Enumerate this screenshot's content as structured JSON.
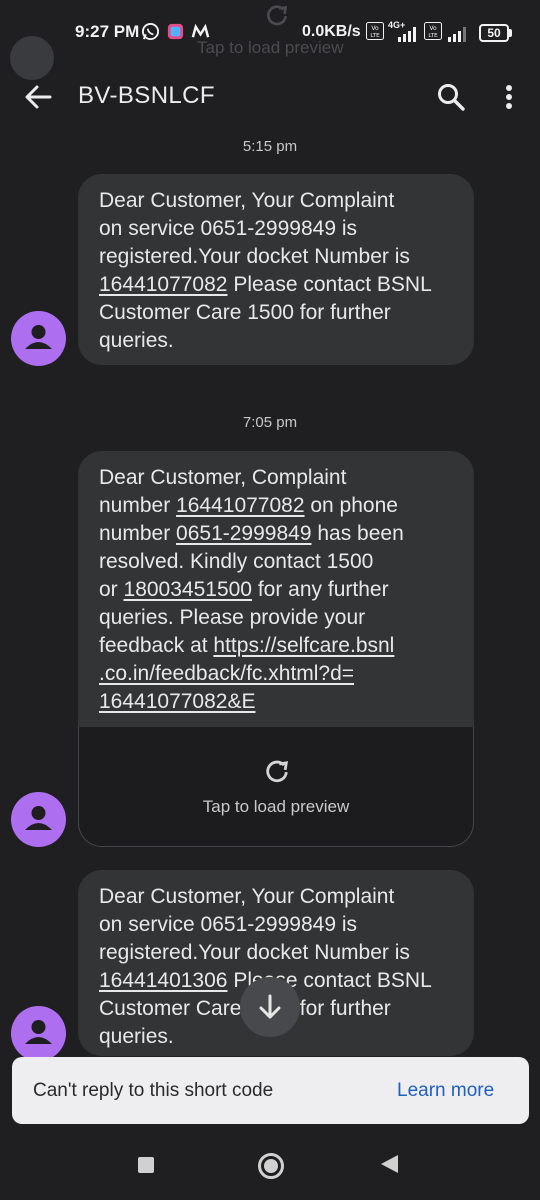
{
  "status_bar": {
    "time": "9:27 PM",
    "speed": "0.0KB/s",
    "battery": "50",
    "volte_label": "Vo LTE",
    "network": "4G+",
    "icons": [
      "whatsapp-icon",
      "app-icon",
      "myjio-icon",
      "volte-icon",
      "signal-icon",
      "battery-icon"
    ]
  },
  "ghost": {
    "text": "Tap to load preview"
  },
  "header": {
    "title": "BV-BSNLCF",
    "icons": [
      "back-arrow-icon",
      "search-icon",
      "more-vert-icon"
    ]
  },
  "messages": [
    {
      "timestamp": "5:15 pm",
      "lines": [
        [
          {
            "t": "Dear Customer, Your Complaint"
          }
        ],
        [
          {
            "t": "on service 0651-2999849 is"
          }
        ],
        [
          {
            "t": "registered.Your docket Number is"
          }
        ],
        [
          {
            "t": "16441077082",
            "u": true
          },
          {
            "t": " Please contact BSNL"
          }
        ],
        [
          {
            "t": "Customer Care 1500 for further"
          }
        ],
        [
          {
            "t": "queries."
          }
        ]
      ]
    },
    {
      "timestamp": "7:05 pm",
      "lines": [
        [
          {
            "t": "Dear Customer, Complaint"
          }
        ],
        [
          {
            "t": "number "
          },
          {
            "t": "16441077082",
            "u": true
          },
          {
            "t": " on phone"
          }
        ],
        [
          {
            "t": "number "
          },
          {
            "t": "0651-2999849",
            "u": true
          },
          {
            "t": " has been"
          }
        ],
        [
          {
            "t": "resolved. Kindly contact 1500"
          }
        ],
        [
          {
            "t": "or "
          },
          {
            "t": "18003451500",
            "u": true
          },
          {
            "t": " for any further"
          }
        ],
        [
          {
            "t": "queries. Please provide your"
          }
        ],
        [
          {
            "t": "feedback at "
          },
          {
            "t": "https://selfcare.bsnl",
            "u": true
          }
        ],
        [
          {
            "t": ".co.in/feedback/fc.xhtml?d=",
            "u": true
          }
        ],
        [
          {
            "t": "16441077082&E",
            "u": true
          }
        ]
      ],
      "preview_label": "Tap to load preview"
    },
    {
      "lines": [
        [
          {
            "t": "Dear Customer, Your Complaint"
          }
        ],
        [
          {
            "t": "on service 0651-2999849 is"
          }
        ],
        [
          {
            "t": "registered.Your docket Number is"
          }
        ],
        [
          {
            "t": "16441401306",
            "u": true
          },
          {
            "t": " Please contact BSNL"
          }
        ],
        [
          {
            "t": "Customer Care 1500 for further"
          }
        ],
        [
          {
            "t": "queries."
          }
        ]
      ]
    }
  ],
  "snackbar": {
    "text": "Can't reply to this short code",
    "action": "Learn more"
  },
  "nav_bar": {
    "icons": [
      "recents-icon",
      "home-icon",
      "back-icon"
    ]
  },
  "colors": {
    "background": "#1f1f21",
    "bubble": "#333436",
    "avatar": "#ad6ff0",
    "link": "#1f5fbf"
  }
}
